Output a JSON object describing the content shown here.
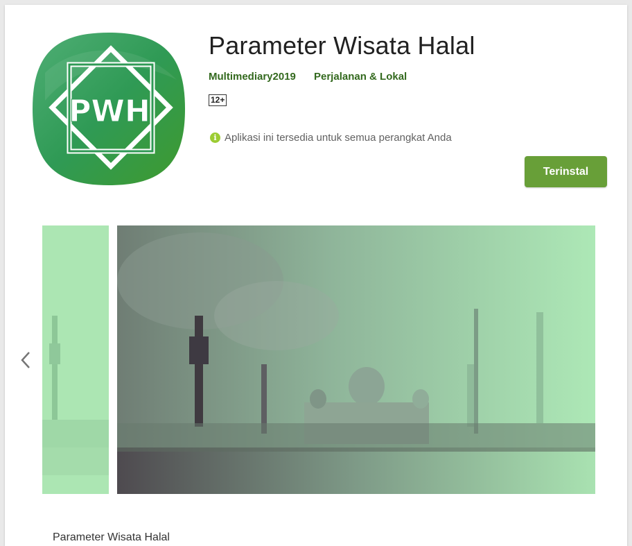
{
  "app": {
    "title": "Parameter Wisata Halal",
    "developer": "Multimediary2019",
    "category": "Perjalanan & Lokal",
    "content_rating": "12+",
    "availability": "Aplikasi ini tersedia untuk semua perangkat Anda",
    "install_label": "Terinstal",
    "icon": "pwh-logo-icon",
    "description_heading": "Parameter Wisata Halal"
  },
  "gallery": {
    "prev_icon": "chevron-left-icon",
    "screenshots": [
      "mosque-screenshot",
      "mosque-screenshot"
    ]
  },
  "colors": {
    "accent": "#689f38",
    "link": "#33691e",
    "icon_green": "#2e8b57",
    "screenshot_tint": "#a8e6b0"
  }
}
